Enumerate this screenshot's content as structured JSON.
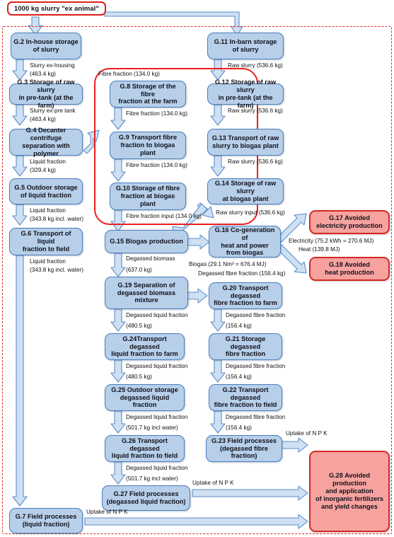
{
  "diagram": {
    "title": "1000 kg slurry \"ex animal\"",
    "boundary_label": "system boundary",
    "highlight_label": "fibre fraction chain highlight"
  },
  "colors": {
    "process_fill": "#b7cfe9",
    "process_border": "#4a7ebb",
    "avoided_fill": "#f6a3a0",
    "avoided_border": "#d32a24",
    "boundary": "#e02a22",
    "highlight": "#ee1d1d",
    "arrow_fill": "#cfe0f2",
    "arrow_stroke": "#5b8fc9"
  },
  "nodes": [
    {
      "id": "G2",
      "label": "G.2 In-house storage\nof slurry"
    },
    {
      "id": "G3",
      "label": "G.3 Storage of raw slurry\nin pre-tank (at the farm)"
    },
    {
      "id": "G4",
      "label": "G.4 Decanter centrifuge\nseparation with polymer"
    },
    {
      "id": "G5",
      "label": "G.5 Outdoor storage\nof liquid fraction"
    },
    {
      "id": "G6",
      "label": "G.6 Transport of liquid\nfraction to field"
    },
    {
      "id": "G7",
      "label": "G.7 Field processes\n(liquid fraction)"
    },
    {
      "id": "G8",
      "label": "G.8 Storage of the fibre\nfraction at the farm"
    },
    {
      "id": "G9",
      "label": "G.9 Transport fibre\nfraction to biogas plant"
    },
    {
      "id": "G10",
      "label": "G.10 Storage of fibre\nfraction at biogas plant"
    },
    {
      "id": "G11",
      "label": "G.11 In-barn storage\nof slurry"
    },
    {
      "id": "G12",
      "label": "G.12 Storage of raw slurry\nin pre-tank (at the farm)"
    },
    {
      "id": "G13",
      "label": "G.13 Transport of raw\nslurry to biogas plant"
    },
    {
      "id": "G14",
      "label": "G.14 Storage of raw slurry\nat biogas plant"
    },
    {
      "id": "G15",
      "label": "G.15 Biogas production"
    },
    {
      "id": "G16",
      "label": "G.16 Co-generation of\nheat and power\nfrom biogas"
    },
    {
      "id": "G17",
      "label": "G.17 Avoided\nelectricity production"
    },
    {
      "id": "G18",
      "label": "G.18 Avoided\nheat production"
    },
    {
      "id": "G19",
      "label": "G.19 Separation of\ndegassed biomass\nmixture"
    },
    {
      "id": "G20",
      "label": "G.20 Transport degassed\nfibre fraction to farm"
    },
    {
      "id": "G21",
      "label": "G.21 Storage degassed\nfibre fraction"
    },
    {
      "id": "G22",
      "label": "G.22 Transport degassed\nfibre fraction to field"
    },
    {
      "id": "G23",
      "label": "G.23 Field processes\n(degassed fibre fraction)"
    },
    {
      "id": "G24",
      "label": "G.24Transport degassed\nliquid fraction to farm"
    },
    {
      "id": "G25",
      "label": "G.25 Outdoor storage\ndegassed liquid fraction"
    },
    {
      "id": "G26",
      "label": "G.26 Transport degassed\nliquid fraction to field"
    },
    {
      "id": "G27",
      "label": "G.27 Field processes\n(degassed liquid fraction)"
    },
    {
      "id": "G28",
      "label": "G.28 Avoided\nproduction\nand application\nof inorganic fertilizers\nand yield changes"
    }
  ],
  "flow_labels": {
    "f_g2_g3_a": "Slurry ex-housing",
    "f_g2_g3_b": "(463.4 kg)",
    "f_g3_g4_a": "Slurry ex-pre tank",
    "f_g3_g4_b": "(463.4 kg)",
    "f_g4_g5_a": "Liquid fraction",
    "f_g4_g5_b": "(329.4 kg)",
    "f_g5_g6_a": "Liquid fraction",
    "f_g5_g6_b": "(343.8 kg incl. water)",
    "f_g6_g7_a": "Liquid fraction",
    "f_g6_g7_b": "(343.8 kg incl. water)",
    "f_g4_g8": "Fibre fraction (134.0 kg)",
    "f_g8_g9": "Fibre fraction (134.0 kg)",
    "f_g9_g10": "Fibre fraction (134.0 kg)",
    "f_g10_g15": "Fibre fraction input (134.0 kg)",
    "f_g11_g12": "Raw slurry (536.6 kg)",
    "f_g12_g13": "Raw slurry (536.6 kg)",
    "f_g13_g14": "Raw slurry (536.6 kg)",
    "f_g14_g15": "Raw slurry input (536.6 kg)",
    "f_g15_g16": "Biogas (29.1 Nm³ = 676.4 MJ)",
    "f_g15_g19_a": "Degassed biomass",
    "f_g15_g19_b": "(637.0 kg)",
    "f_g16_g17": "Electricity (75.2 kWh = 270.6 MJ)",
    "f_g16_g18": "Heat (139.8 MJ)",
    "f_g19_g20": "Degassed fibre fraction (156.4 kg)",
    "f_g19_g24_a": "Degassed liquid fraction",
    "f_g19_g24_b": "(480.5 kg)",
    "f_g20_g21_a": "Degassed fibre fraction",
    "f_g20_g21_b": "(156.4 kg)",
    "f_g21_g22_a": "Degassed fibre fraction",
    "f_g21_g22_b": "(156.4 kg)",
    "f_g22_g23_a": "Degassed fibre fraction",
    "f_g22_g23_b": "(156.4 kg)",
    "f_g24_g25_a": "Degassed liquid fraction",
    "f_g24_g25_b": "(480.5 kg)",
    "f_g25_g26_a": "Degassed liquid fraction",
    "f_g25_g26_b": "(501.7 kg incl water)",
    "f_g26_g27_a": "Degassed liquid fraction",
    "f_g26_g27_b": "(501.7 kg incl water)",
    "f_g23_g28": "Uptake of N P K",
    "f_g27_g28": "Uptake of N P K",
    "f_g7_g28": "Uptake of N P K"
  }
}
